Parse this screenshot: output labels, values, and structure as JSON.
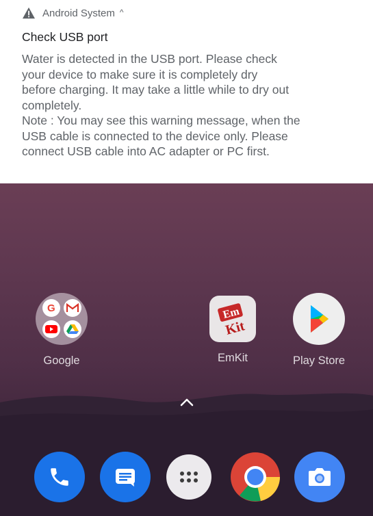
{
  "notification": {
    "app_name": "Android System",
    "title": "Check USB port",
    "body_lines": [
      "Water is detected in the USB port. Please check",
      "your device to make sure it is completely dry",
      "before charging. It may take a little while to dry out",
      "completely.",
      "Note : You may see this warning message, when the",
      "USB cable is connected to the device only. Please",
      "connect USB cable into AC adapter or PC first."
    ]
  },
  "home": {
    "apps": [
      {
        "label": "Google"
      },
      {
        "label": "EmKit"
      },
      {
        "label": "Play Store"
      }
    ],
    "dock": [
      "phone-icon",
      "messages-icon",
      "app-drawer-icon",
      "chrome-icon",
      "camera-icon"
    ]
  },
  "colors": {
    "warning": "#5f6368",
    "phone": "#1a73e8",
    "messages": "#1a73e8",
    "camera": "#4285f4"
  }
}
